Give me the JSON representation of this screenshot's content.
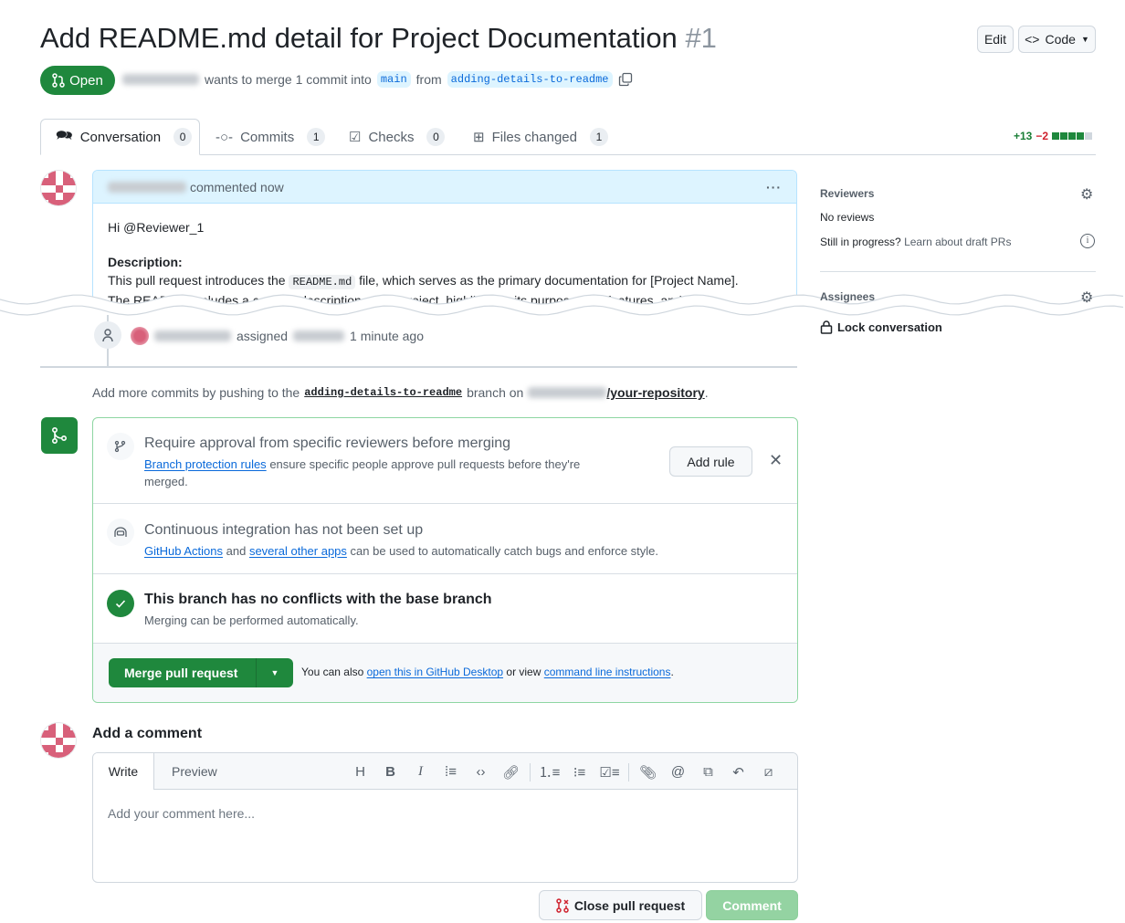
{
  "header": {
    "title": "Add README.md detail for Project Documentation",
    "number": "#1",
    "edit_label": "Edit",
    "code_label": "Code",
    "state": "Open",
    "merge_text": "wants to merge 1 commit into",
    "base_branch": "main",
    "from_text": "from",
    "head_branch": "adding-details-to-readme"
  },
  "tabs": [
    {
      "label": "Conversation",
      "count": "0"
    },
    {
      "label": "Commits",
      "count": "1"
    },
    {
      "label": "Checks",
      "count": "0"
    },
    {
      "label": "Files changed",
      "count": "1"
    }
  ],
  "diffstat": {
    "additions": "+13",
    "deletions": "−2",
    "blocks": [
      1,
      1,
      1,
      1,
      0
    ]
  },
  "comment": {
    "action": "commented now",
    "greeting": "Hi @Reviewer_1",
    "desc_heading": "Description:",
    "desc_pre": "This pull request introduces the",
    "code": "README.md",
    "desc_post": "file, which serves as the primary documentation for [Project Name].",
    "desc_cut": "The README includes a concise description of the project, highlighting its purpose, key features, and"
  },
  "event": {
    "action": "assigned",
    "time": "1 minute ago"
  },
  "push_hint": {
    "pre": "Add more commits by pushing to the",
    "branch": "adding-details-to-readme",
    "mid": "branch on",
    "repo": "/your-repository",
    "end": "."
  },
  "merge_box": {
    "rule": {
      "title": "Require approval from specific reviewers before merging",
      "link": "Branch protection rules",
      "text": "ensure specific people approve pull requests before they're merged.",
      "button": "Add rule"
    },
    "ci": {
      "title": "Continuous integration has not been set up",
      "link1": "GitHub Actions",
      "and": "and",
      "link2": "several other apps",
      "text": "can be used to automatically catch bugs and enforce style."
    },
    "conflicts": {
      "title": "This branch has no conflicts with the base branch",
      "text": "Merging can be performed automatically."
    },
    "merge_button": "Merge pull request",
    "also_pre": "You can also",
    "desktop_link": "open this in GitHub Desktop",
    "or_view": "or view",
    "cli_link": "command line instructions",
    "end": "."
  },
  "add_comment": {
    "heading": "Add a comment",
    "write_tab": "Write",
    "preview_tab": "Preview",
    "placeholder": "Add your comment here...",
    "close_button": "Close pull request",
    "comment_button": "Comment"
  },
  "sidebar": {
    "reviewers": "Reviewers",
    "no_reviews": "No reviews",
    "in_progress": "Still in progress?",
    "draft_link": "Learn about draft PRs",
    "assignees": "Assignees",
    "lock": "Lock conversation"
  },
  "colors": {
    "green": "#1f883d",
    "link": "#0969da",
    "red": "#cf222e"
  }
}
